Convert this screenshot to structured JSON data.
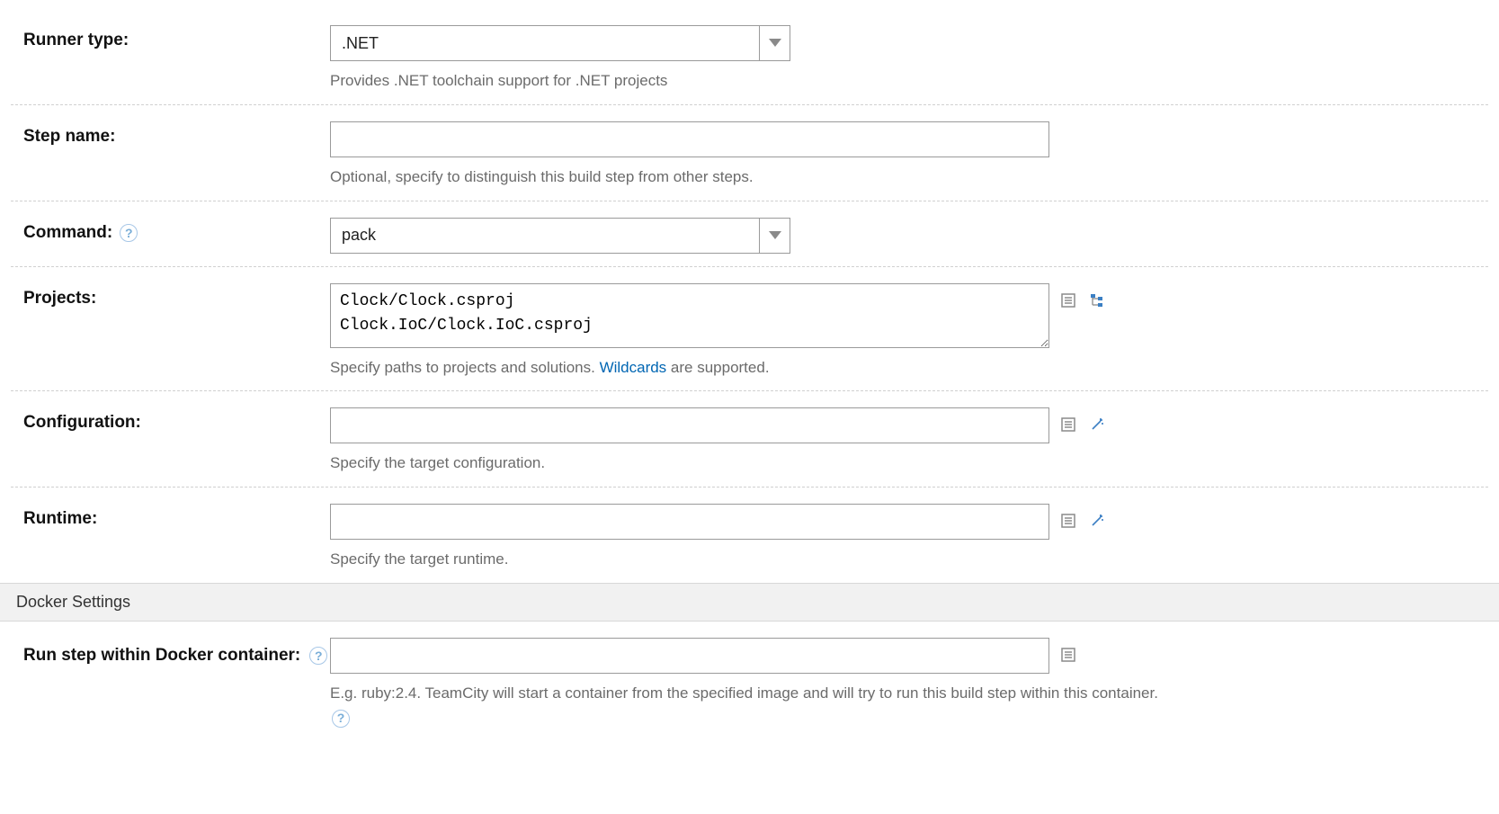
{
  "runnerType": {
    "label": "Runner type:",
    "value": ".NET",
    "help": "Provides .NET toolchain support for .NET projects"
  },
  "stepName": {
    "label": "Step name:",
    "value": "",
    "help": "Optional, specify to distinguish this build step from other steps."
  },
  "command": {
    "label": "Command:",
    "value": "pack"
  },
  "projects": {
    "label": "Projects:",
    "value": "Clock/Clock.csproj\nClock.IoC/Clock.IoC.csproj",
    "help_before": "Specify paths to projects and solutions. ",
    "help_link": "Wildcards",
    "help_after": " are supported."
  },
  "configuration": {
    "label": "Configuration:",
    "value": "",
    "help": "Specify the target configuration."
  },
  "runtime": {
    "label": "Runtime:",
    "value": "",
    "help": "Specify the target runtime."
  },
  "dockerSection": {
    "title": "Docker Settings"
  },
  "dockerContainer": {
    "label": "Run step within Docker container:",
    "value": "",
    "help": "E.g. ruby:2.4. TeamCity will start a container from the specified image and will try to run this build step within this container."
  }
}
